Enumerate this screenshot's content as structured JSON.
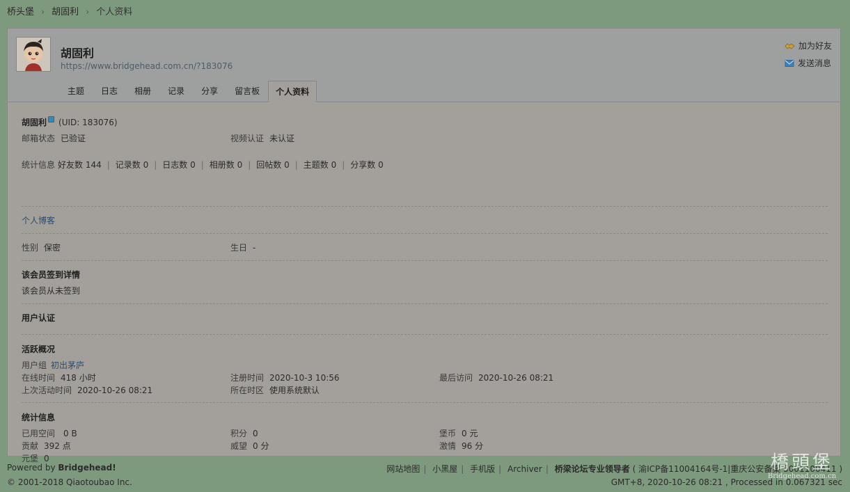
{
  "breadcrumb": {
    "items": [
      "桥头堡",
      "胡固利",
      "个人资料"
    ],
    "sep": "›"
  },
  "header": {
    "name": "胡固利",
    "url": "https://www.bridgehead.com.cn/?183076",
    "actions": {
      "add_friend": "加为好友",
      "send_message": "发送消息"
    },
    "tabs": [
      "主题",
      "日志",
      "相册",
      "记录",
      "分享",
      "留言板",
      "个人资料"
    ]
  },
  "profile": {
    "name": "胡固利",
    "uid": "(UID: 183076)",
    "email_label": "邮箱状态",
    "email_value": "已验证",
    "video_label": "视频认证",
    "video_value": "未认证",
    "stats_label": "统计信息",
    "stats": [
      "好友数 144",
      "记录数 0",
      "日志数 0",
      "相册数 0",
      "回帖数 0",
      "主题数 0",
      "分享数 0"
    ],
    "blog_link": "个人博客",
    "gender_label": "性别",
    "gender_value": "保密",
    "birthday_label": "生日",
    "birthday_value": "-"
  },
  "signin": {
    "title": "该会员签到详情",
    "text": "该会员从未签到"
  },
  "auth": {
    "title": "用户认证"
  },
  "activity": {
    "title": "活跃概况",
    "group_label": "用户组",
    "group_value": "初出茅庐",
    "online_label": "在线时间",
    "online_value": "418 小时",
    "register_label": "注册时间",
    "register_value": "2020-10-3 10:56",
    "lastvisit_label": "最后访问",
    "lastvisit_value": "2020-10-26 08:21",
    "lastactive_label": "上次活动时间",
    "lastactive_value": "2020-10-26 08:21",
    "timezone_label": "所在时区",
    "timezone_value": "使用系统默认"
  },
  "stats2": {
    "title": "统计信息",
    "space_label": "已用空间",
    "space_value": "0 B",
    "points_label": "积分",
    "points_value": "0",
    "coins_label": "堡币",
    "coins_value": "0 元",
    "contrib_label": "贡献",
    "contrib_value": "392 点",
    "prestige_label": "威望",
    "prestige_value": "0 分",
    "passion_label": "激情",
    "passion_value": "96 分",
    "yuanbao_label": "元堡",
    "yuanbao_value": "0"
  },
  "footer": {
    "powered_prefix": "Powered by ",
    "powered_brand": "Bridgehead!",
    "copyright": "© 2001-2018 Qiaotoubao Inc.",
    "links": [
      "网站地图",
      "小黑屋",
      "手机版",
      "Archiver"
    ],
    "slogan": "桥梁论坛专业领导者",
    "icp": "( 渝ICP备11004164号-1|重庆公安备案 50011",
    "icp_tail": "00411 )",
    "gmt": "GMT+8, 2020-10-26 08:21 , Processed in 0.067321 sec"
  },
  "watermark": {
    "big": "橋頭堡",
    "small": "Bridgehead.com.cn"
  },
  "colors": {
    "background": "#7e9a7e",
    "panel": "#a3a09b",
    "header": "#9ea09f",
    "link": "#2c4a6e",
    "badge": "#3a87b7"
  }
}
